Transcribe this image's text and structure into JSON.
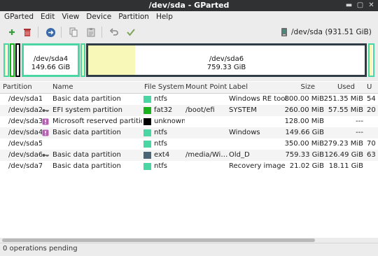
{
  "window": {
    "title": "/dev/sda - GParted"
  },
  "menu": [
    "GParted",
    "Edit",
    "View",
    "Device",
    "Partition",
    "Help"
  ],
  "toolbar": {
    "icons": [
      "new-partition-icon",
      "delete-partition-icon",
      "resize-move-icon",
      "copy-icon",
      "paste-icon",
      "undo-icon",
      "apply-icon"
    ],
    "device_label": "/dev/sda  (931.51 GiB)"
  },
  "graphic": {
    "sda4": {
      "name": "/dev/sda4",
      "size": "149.66 GiB"
    },
    "sda6": {
      "name": "/dev/sda6",
      "size": "759.33 GiB"
    },
    "colors": {
      "ntfs": "#4ad6a2",
      "fat32": "#19b21d",
      "ext4": "#4a6575",
      "unknown": "#000000",
      "used": "#f8f8b8",
      "selected_border": "#2f3b45"
    }
  },
  "columns": [
    "Partition",
    "Name",
    "File System",
    "Mount Point",
    "Label",
    "Size",
    "Used",
    "U"
  ],
  "partitions": [
    {
      "partition": "/dev/sda1",
      "flag": "",
      "name": "Basic data partition",
      "fs": "ntfs",
      "fs_color": "#4ad6a2",
      "mount": "",
      "label": "Windows RE tools",
      "size": "800.00 MiB",
      "used": "251.35 MiB",
      "unused": "54"
    },
    {
      "partition": "/dev/sda2",
      "flag": "key",
      "name": "EFI system partition",
      "fs": "fat32",
      "fs_color": "#19b21d",
      "mount": "/boot/efi",
      "label": "SYSTEM",
      "size": "260.00 MiB",
      "used": "57.55 MiB",
      "unused": "20"
    },
    {
      "partition": "/dev/sda3",
      "flag": "warn",
      "name": "Microsoft reserved partition",
      "fs": "unknown",
      "fs_color": "#000000",
      "mount": "",
      "label": "",
      "size": "128.00 MiB",
      "used": "---",
      "unused": ""
    },
    {
      "partition": "/dev/sda4",
      "flag": "warn",
      "name": "Basic data partition",
      "fs": "ntfs",
      "fs_color": "#4ad6a2",
      "mount": "",
      "label": "Windows",
      "size": "149.66 GiB",
      "used": "---",
      "unused": ""
    },
    {
      "partition": "/dev/sda5",
      "flag": "",
      "name": "",
      "fs": "ntfs",
      "fs_color": "#4ad6a2",
      "mount": "",
      "label": "",
      "size": "350.00 MiB",
      "used": "279.23 MiB",
      "unused": "70"
    },
    {
      "partition": "/dev/sda6",
      "flag": "key",
      "name": "Basic data partition",
      "fs": "ext4",
      "fs_color": "#4a6575",
      "mount": "/media/Wi…",
      "label": "Old_D",
      "size": "759.33 GiB",
      "used": "126.49 GiB",
      "unused": "63"
    },
    {
      "partition": "/dev/sda7",
      "flag": "",
      "name": "Basic data partition",
      "fs": "ntfs",
      "fs_color": "#4ad6a2",
      "mount": "",
      "label": "Recovery image",
      "size": "21.02 GiB",
      "used": "18.11 GiB",
      "unused": ""
    }
  ],
  "status": "0 operations pending"
}
